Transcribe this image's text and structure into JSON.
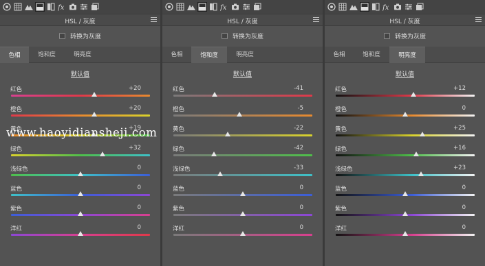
{
  "watermark": "www.haoyidiansheji.com",
  "toolbar_icons": [
    "aperture-icon",
    "grid-icon",
    "mountains-icon",
    "hsl-panel-icon",
    "split-toning-icon",
    "fx-icon",
    "camera-icon",
    "sliders-icon",
    "presets-icon"
  ],
  "hue_colors": {
    "red": "#e0394a",
    "orange": "#e88a2f",
    "yellow": "#d9d22c",
    "green": "#4fbf4a",
    "aqua": "#3ec1c8",
    "blue": "#3c5ed8",
    "purple": "#8c47d6",
    "magenta": "#d8408e"
  },
  "panels": [
    {
      "title": "HSL / 灰度",
      "grayscale_label": "转换为灰度",
      "tabs": [
        "色相",
        "饱和度",
        "明亮度"
      ],
      "active_tab": 0,
      "section_title": "默认值",
      "sliders": [
        {
          "label": "红色",
          "value": "+20",
          "numeric": 20
        },
        {
          "label": "橙色",
          "value": "+20",
          "numeric": 20
        },
        {
          "label": "黄色",
          "value": "+19",
          "numeric": 19
        },
        {
          "label": "绿色",
          "value": "+32",
          "numeric": 32
        },
        {
          "label": "浅绿色",
          "value": "0",
          "numeric": 0
        },
        {
          "label": "蓝色",
          "value": "0",
          "numeric": 0
        },
        {
          "label": "紫色",
          "value": "0",
          "numeric": 0
        },
        {
          "label": "洋红",
          "value": "0",
          "numeric": 0
        }
      ]
    },
    {
      "title": "HSL / 灰度",
      "grayscale_label": "转换为灰度",
      "tabs": [
        "色相",
        "饱和度",
        "明亮度"
      ],
      "active_tab": 1,
      "section_title": "默认值",
      "sliders": [
        {
          "label": "红色",
          "value": "-41",
          "numeric": -41
        },
        {
          "label": "橙色",
          "value": "-5",
          "numeric": -5
        },
        {
          "label": "黄色",
          "value": "-22",
          "numeric": -22
        },
        {
          "label": "绿色",
          "value": "-42",
          "numeric": -42
        },
        {
          "label": "浅绿色",
          "value": "-33",
          "numeric": -33
        },
        {
          "label": "蓝色",
          "value": "0",
          "numeric": 0
        },
        {
          "label": "紫色",
          "value": "0",
          "numeric": 0
        },
        {
          "label": "洋红",
          "value": "0",
          "numeric": 0
        }
      ]
    },
    {
      "title": "HSL / 灰度",
      "grayscale_label": "转换为灰度",
      "tabs": [
        "色相",
        "饱和度",
        "明亮度"
      ],
      "active_tab": 2,
      "section_title": "默认值",
      "sliders": [
        {
          "label": "红色",
          "value": "+12",
          "numeric": 12
        },
        {
          "label": "橙色",
          "value": "0",
          "numeric": 0
        },
        {
          "label": "黄色",
          "value": "+25",
          "numeric": 25
        },
        {
          "label": "绿色",
          "value": "+16",
          "numeric": 16
        },
        {
          "label": "浅绿色",
          "value": "+23",
          "numeric": 23
        },
        {
          "label": "蓝色",
          "value": "0",
          "numeric": 0
        },
        {
          "label": "紫色",
          "value": "0",
          "numeric": 0
        },
        {
          "label": "洋红",
          "value": "0",
          "numeric": 0
        }
      ]
    }
  ]
}
